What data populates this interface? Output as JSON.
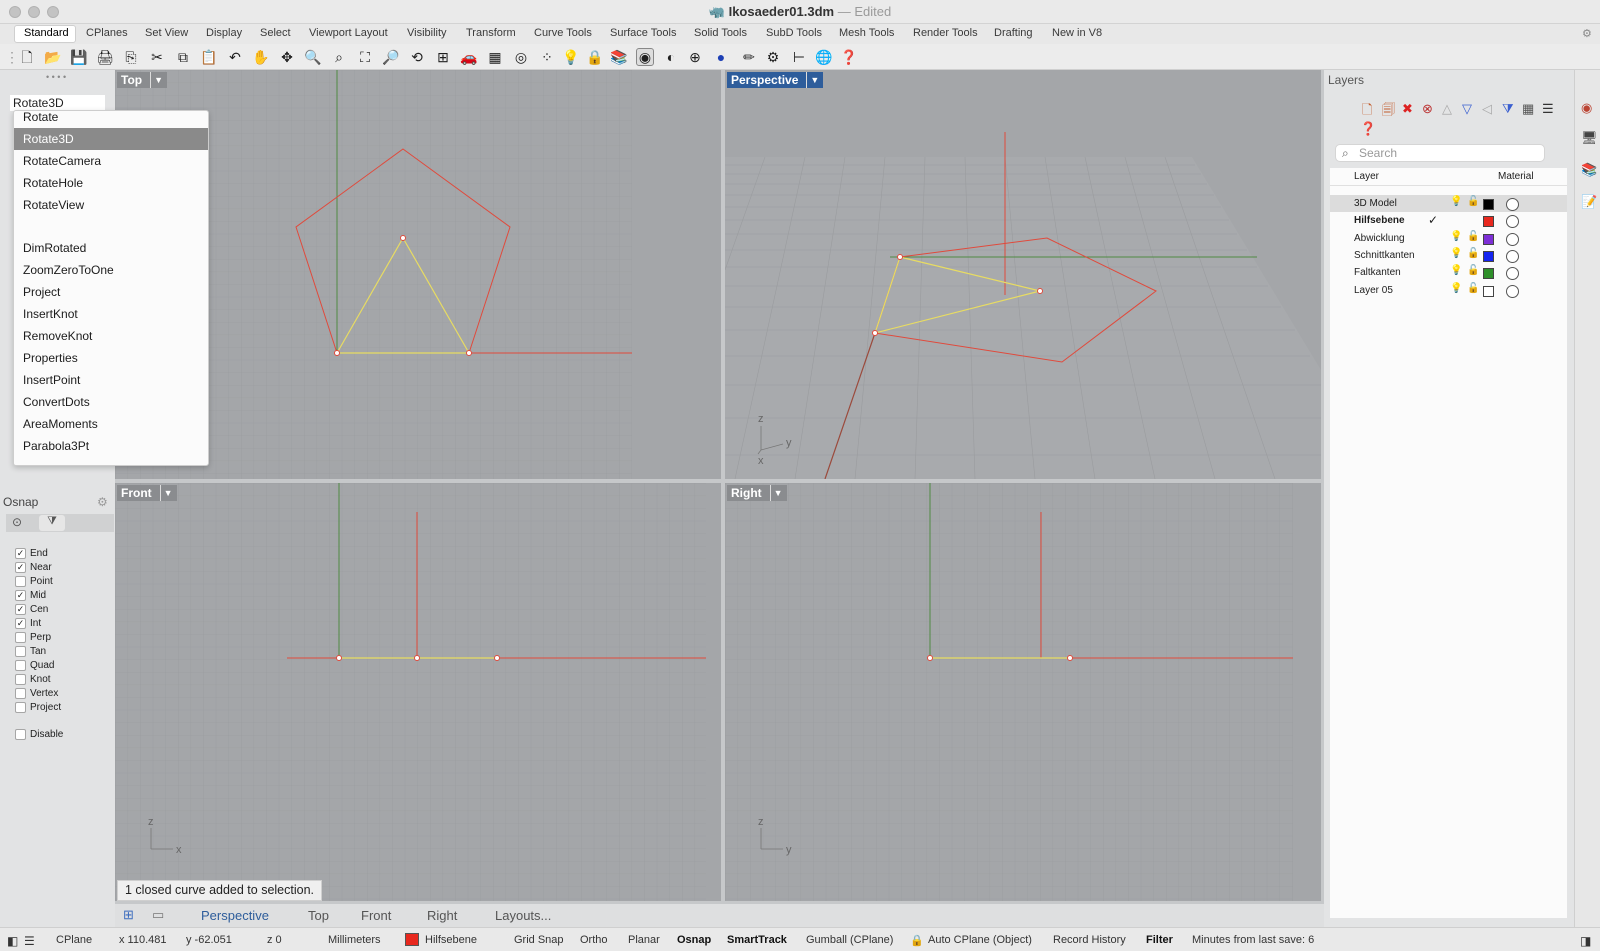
{
  "window": {
    "title": "Ikosaeder01.3dm",
    "separator": "—",
    "state": "Edited"
  },
  "tabs": [
    "Standard",
    "CPlanes",
    "Set View",
    "Display",
    "Select",
    "Viewport Layout",
    "Visibility",
    "Transform",
    "Curve Tools",
    "Surface Tools",
    "Solid Tools",
    "SubD Tools",
    "Mesh Tools",
    "Render Tools",
    "Drafting",
    "New in V8"
  ],
  "command": {
    "input_value": "Rotate3D",
    "suggestions": [
      "Rotate",
      "Rotate3D",
      "RotateCamera",
      "RotateHole",
      "RotateView",
      "DimRotated",
      "ZoomZeroToOne",
      "Project",
      "InsertKnot",
      "RemoveKnot",
      "Properties",
      "InsertPoint",
      "ConvertDots",
      "AreaMoments",
      "Parabola3Pt"
    ],
    "selected": "Rotate3D"
  },
  "osnap": {
    "title": "Osnap",
    "items": [
      {
        "label": "End",
        "checked": true
      },
      {
        "label": "Near",
        "checked": true
      },
      {
        "label": "Point",
        "checked": false
      },
      {
        "label": "Mid",
        "checked": true
      },
      {
        "label": "Cen",
        "checked": true
      },
      {
        "label": "Int",
        "checked": true
      },
      {
        "label": "Perp",
        "checked": false
      },
      {
        "label": "Tan",
        "checked": false
      },
      {
        "label": "Quad",
        "checked": false
      },
      {
        "label": "Knot",
        "checked": false
      },
      {
        "label": "Vertex",
        "checked": false
      },
      {
        "label": "Project",
        "checked": false
      }
    ],
    "disable_label": "Disable"
  },
  "viewports": {
    "top": "Top",
    "perspective": "Perspective",
    "front": "Front",
    "right": "Right",
    "axes": {
      "x": "x",
      "y": "y",
      "z": "z"
    }
  },
  "layers": {
    "title": "Layers",
    "search_placeholder": "Search",
    "col_layer": "Layer",
    "col_material": "Material",
    "rows": [
      {
        "name": "3D Model",
        "color": "#000000",
        "current": false,
        "bold": false,
        "selected": true
      },
      {
        "name": "Hilfsebene",
        "color": "#e8281e",
        "current": true,
        "bold": true,
        "selected": false
      },
      {
        "name": "Abwicklung",
        "color": "#7d2fd6",
        "current": false,
        "bold": false,
        "selected": false
      },
      {
        "name": "Schnittkanten",
        "color": "#1424f0",
        "current": false,
        "bold": false,
        "selected": false
      },
      {
        "name": "Faltkanten",
        "color": "#2e8f2a",
        "current": false,
        "bold": false,
        "selected": false
      },
      {
        "name": "Layer 05",
        "color": "#ffffff",
        "current": false,
        "bold": false,
        "selected": false
      }
    ]
  },
  "viewport_tabs": [
    "Perspective",
    "Top",
    "Front",
    "Right",
    "Layouts..."
  ],
  "status_message": "1 closed curve added to selection.",
  "statusbar": {
    "cplane": "CPlane",
    "x": "x 110.481",
    "y": "y -62.051",
    "z": "z 0",
    "units": "Millimeters",
    "layer": "Hilfsebene",
    "layer_color": "#e8281e",
    "grid_snap": "Grid Snap",
    "ortho": "Ortho",
    "planar": "Planar",
    "osnap": "Osnap",
    "smarttrack": "SmartTrack",
    "gumball": "Gumball (CPlane)",
    "auto_cplane": "Auto CPlane (Object)",
    "record_history": "Record History",
    "filter": "Filter",
    "save_info": "Minutes from last save: 6"
  },
  "colors": {
    "viewport_bg": "#a4a6a9",
    "grid_line": "#999b9e",
    "red_curve": "#e04a3c",
    "yellow_curve": "#e8dc62",
    "green_axis": "#4f8a44",
    "active_viewport": "#2e5d9b"
  }
}
